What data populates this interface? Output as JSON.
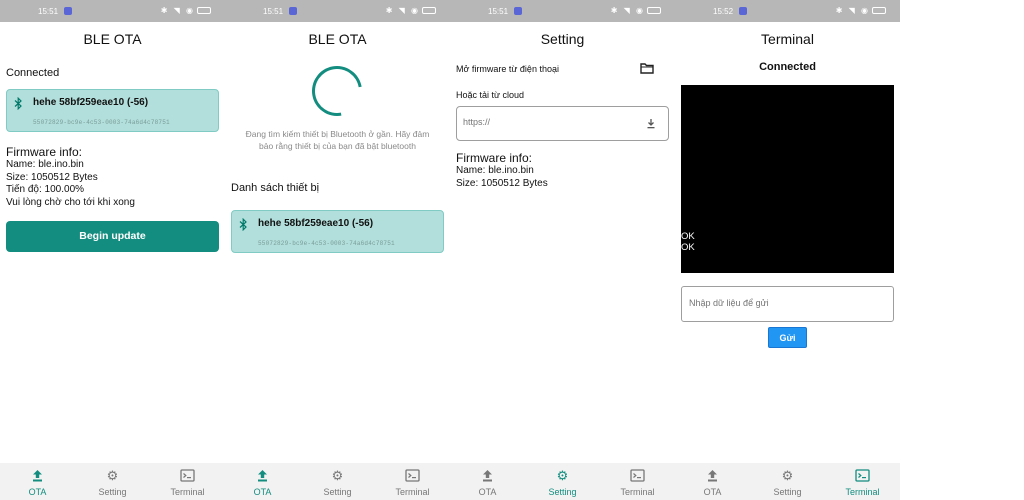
{
  "status": {
    "time1": "15:51",
    "time2": "15:51",
    "time3": "15:51",
    "time4": "15:52"
  },
  "screens": {
    "ota": {
      "title": "BLE OTA",
      "connected_label": "Connected",
      "device": {
        "name": "hehe 58bf259eae10  (-56)",
        "uuid": "55072829-bc9e-4c53-0003-74a6d4c78751"
      },
      "firmware_header": "Firmware info:",
      "firmware_name": "Name: ble.ino.bin",
      "firmware_size": "Size: 1050512 Bytes",
      "progress": "Tiến độ: 100.00%",
      "wait_msg": "Vui lòng chờ cho tới khi xong",
      "begin_button": "Begin update"
    },
    "scan": {
      "title": "BLE OTA",
      "scan_message": "Đang tìm kiếm thiết bị Bluetooth ở gần. Hãy đảm bảo rằng thiết bị của bạn đã bật bluetooth",
      "list_label": "Danh sách thiết bị",
      "device": {
        "name": "hehe 58bf259eae10  (-56)",
        "uuid": "55072829-bc9e-4c53-0003-74a6d4c78751"
      }
    },
    "setting": {
      "title": "Setting",
      "open_local": "Mở firmware từ điện thoại",
      "cloud_label": "Hoặc tải từ cloud",
      "url_placeholder": "https://",
      "firmware_header": "Firmware info:",
      "firmware_name": "Name: ble.ino.bin",
      "firmware_size": "Size: 1050512 Bytes"
    },
    "terminal": {
      "title": "Terminal",
      "connected_label": "Connected",
      "output_lines": [
        "OK",
        "OK"
      ],
      "input_placeholder": "Nhập dữ liệu để gửi",
      "send_button": "Gửi"
    }
  },
  "nav": {
    "ota": "OTA",
    "setting": "Setting",
    "terminal": "Terminal"
  },
  "colors": {
    "accent": "#138d7f",
    "card": "#b2dfdb",
    "send": "#2196f3",
    "statusbar": "#b7b7b7"
  },
  "icons": {
    "bluetooth": "bluetooth-icon",
    "folder": "folder-icon",
    "download": "download-icon",
    "upload": "upload-icon",
    "gear": "gear-icon",
    "terminal": "terminal-icon"
  }
}
